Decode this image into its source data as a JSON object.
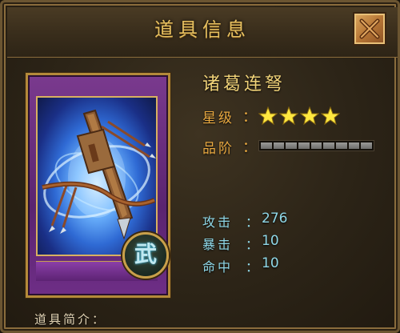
{
  "header": {
    "title": "道具信息",
    "close_icon": "close-x-icon"
  },
  "item": {
    "name": "诸葛连弩",
    "card_icon": "crossbow-weapon-art",
    "card_badge": "武",
    "star_label": "星级",
    "star_count": 4,
    "star_max": 4,
    "grade_label": "品阶",
    "grade_segments": 9,
    "grade_filled": 0,
    "colon": "："
  },
  "stats": [
    {
      "label": "攻击",
      "value": "276"
    },
    {
      "label": "暴击",
      "value": "10"
    },
    {
      "label": "命中",
      "value": "10"
    }
  ],
  "description": {
    "label": "道具简介："
  },
  "colors": {
    "title_gold": "#e6c060",
    "label_orange": "#e8a840",
    "stat_cyan": "#8fd8e8",
    "star_yellow": "#ffe840",
    "card_purple": "#6e2e86"
  }
}
